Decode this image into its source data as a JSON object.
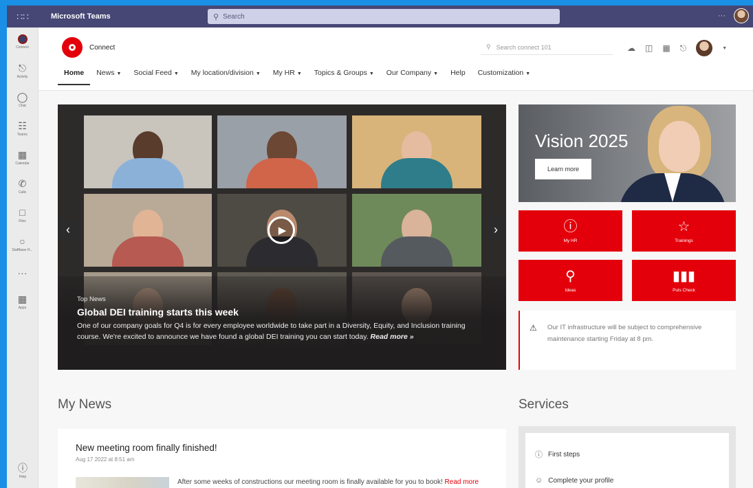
{
  "teams": {
    "app_name": "Microsoft Teams",
    "search_placeholder": "Search",
    "more": "···",
    "rail": [
      {
        "label": "Connect",
        "icon": "connect-icon"
      },
      {
        "label": "Activity",
        "icon": "bell-icon"
      },
      {
        "label": "Chat",
        "icon": "chat-icon"
      },
      {
        "label": "Teams",
        "icon": "teams-icon"
      },
      {
        "label": "Calendar",
        "icon": "calendar-icon"
      },
      {
        "label": "Calls",
        "icon": "phone-icon"
      },
      {
        "label": "Files",
        "icon": "file-icon"
      },
      {
        "label": "Staffbase H...",
        "icon": "staffbase-icon"
      }
    ],
    "rail_more": "···",
    "rail_apps": "Apps",
    "rail_help": "Help"
  },
  "header": {
    "brand": "Connect",
    "search_placeholder": "Search connect 101",
    "nav": [
      {
        "label": "Home",
        "dropdown": false,
        "active": true
      },
      {
        "label": "News",
        "dropdown": true
      },
      {
        "label": "Social Feed",
        "dropdown": true
      },
      {
        "label": "My location/division",
        "dropdown": true
      },
      {
        "label": "My HR",
        "dropdown": true
      },
      {
        "label": "Topics & Groups",
        "dropdown": true
      },
      {
        "label": "Our Company",
        "dropdown": true
      },
      {
        "label": "Help",
        "dropdown": false
      },
      {
        "label": "Customization",
        "dropdown": true
      }
    ]
  },
  "hero": {
    "kicker": "Top News",
    "title": "Global DEI training starts this week",
    "body": "One of our company goals for Q4 is for every employee worldwide to take part in a Diversity, Equity, and Inclusion training course. We're excited to announce we have found a global DEI training you can start today.",
    "read_more": "Read more »"
  },
  "vision": {
    "title": "Vision 2025",
    "button": "Learn more"
  },
  "quick_links": [
    {
      "label": "My HR",
      "icon": "info-icon"
    },
    {
      "label": "Trainings",
      "icon": "star-icon"
    },
    {
      "label": "Ideas",
      "icon": "lightbulb-icon"
    },
    {
      "label": "Puls Check",
      "icon": "bar-chart-icon"
    }
  ],
  "alert": {
    "text": "Our IT infrastructure will be subject to comprehensive maintenance starting Friday at 8 pm."
  },
  "my_news": {
    "heading": "My News",
    "title": "New meeting room finally finished!",
    "date": "Aug 17 2022 at 8:51 am",
    "snippet": "After some weeks of constructions our meeting room is finally available for you to book!",
    "read_more": "Read more"
  },
  "services": {
    "heading": "Services",
    "items": [
      {
        "label": "First steps",
        "icon": "info-icon"
      },
      {
        "label": "Complete your profile",
        "icon": "person-icon"
      }
    ]
  },
  "colors": {
    "teams_bar": "#464775",
    "brand_red": "#e3000b",
    "backdrop": "#1a8fe6"
  }
}
